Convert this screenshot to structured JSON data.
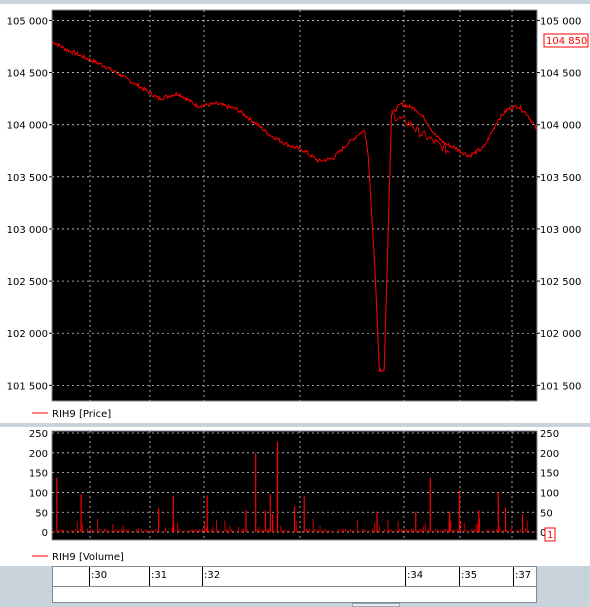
{
  "colors": {
    "series": "#ff0000",
    "background": "#000000",
    "grid": "#d0d0d0",
    "panel": "#ffffff",
    "frame": "#c9d3dc"
  },
  "price_panel": {
    "legend": "RIH9 [Price]",
    "last_value": "104 850"
  },
  "volume_panel": {
    "legend": "RIH9 [Volume]",
    "last_value": "1"
  },
  "time_axis": {
    "labels": [
      ":30",
      ":31",
      ":32",
      ":34",
      ":35",
      ":37"
    ]
  },
  "chart_data": [
    {
      "type": "line",
      "series": [
        {
          "name": "RIH9 [Price]"
        }
      ],
      "y_ticks": [
        "105 000",
        "104 500",
        "104 000",
        "103 500",
        "103 000",
        "102 500",
        "102 000",
        "101 500"
      ],
      "ylim": [
        101350,
        105100
      ],
      "x": [
        0,
        3,
        7,
        11,
        15,
        19,
        22,
        26,
        30,
        34,
        38,
        41,
        45,
        49,
        52,
        55,
        58,
        61,
        63,
        64.5,
        65.2,
        66.6,
        67.5,
        68.5,
        70,
        72,
        75,
        77,
        79,
        81,
        83,
        86,
        89,
        92,
        94,
        96,
        98,
        100
      ],
      "values": [
        104800,
        104720,
        104640,
        104560,
        104450,
        104340,
        104250,
        104300,
        104180,
        104200,
        104150,
        104050,
        103900,
        103800,
        103750,
        103650,
        103680,
        103820,
        103900,
        103950,
        103700,
        102600,
        101650,
        101650,
        104100,
        104200,
        104150,
        104050,
        103900,
        103820,
        103780,
        103700,
        103780,
        104050,
        104150,
        104180,
        104100,
        103950
      ],
      "grid": true,
      "grid_style": "dashed"
    },
    {
      "type": "bar",
      "series": [
        {
          "name": "RIH9 [Volume]"
        }
      ],
      "y_ticks": [
        "250",
        "200",
        "150",
        "100",
        "50",
        "0"
      ],
      "ylim": [
        -20,
        255
      ],
      "spikes": [
        {
          "x": 1,
          "v": 137
        },
        {
          "x": 6,
          "v": 95
        },
        {
          "x": 22,
          "v": 60
        },
        {
          "x": 25,
          "v": 92
        },
        {
          "x": 32,
          "v": 92
        },
        {
          "x": 40,
          "v": 55
        },
        {
          "x": 42,
          "v": 200
        },
        {
          "x": 44,
          "v": 55
        },
        {
          "x": 45,
          "v": 95
        },
        {
          "x": 45.5,
          "v": 45
        },
        {
          "x": 46.5,
          "v": 228
        },
        {
          "x": 50,
          "v": 65
        },
        {
          "x": 52,
          "v": 90
        },
        {
          "x": 67,
          "v": 52
        },
        {
          "x": 75,
          "v": 52
        },
        {
          "x": 78,
          "v": 137
        },
        {
          "x": 82,
          "v": 52
        },
        {
          "x": 84,
          "v": 105
        },
        {
          "x": 88,
          "v": 55
        },
        {
          "x": 92,
          "v": 100
        },
        {
          "x": 93.5,
          "v": 62
        },
        {
          "x": 97,
          "v": 45
        }
      ],
      "grid": true,
      "grid_style": "dashed"
    }
  ]
}
